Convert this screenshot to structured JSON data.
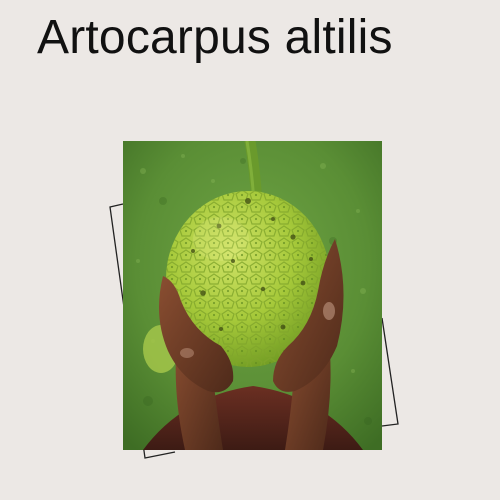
{
  "title": "Artocarpus altilis",
  "photo": {
    "subject": "breadfruit-held-in-hands",
    "colors": {
      "background": "#ece8e5",
      "grass": "#5e9338",
      "fruit": "#a9cc3c",
      "skin": "#6b3a25"
    }
  }
}
